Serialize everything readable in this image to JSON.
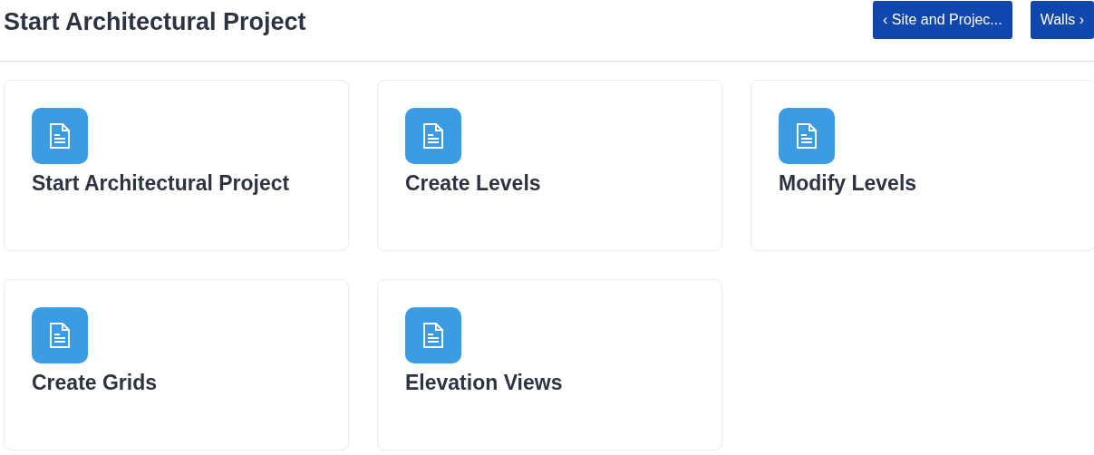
{
  "title": "Start Architectural Project",
  "nav_buttons": [
    {
      "label": "‹ Site and Projec..."
    },
    {
      "label": "Walls ›"
    }
  ],
  "cards": [
    {
      "title": "Start Architectural Project"
    },
    {
      "title": "Create Levels"
    },
    {
      "title": "Modify Levels"
    },
    {
      "title": "Create Grids"
    },
    {
      "title": "Elevation Views"
    }
  ]
}
